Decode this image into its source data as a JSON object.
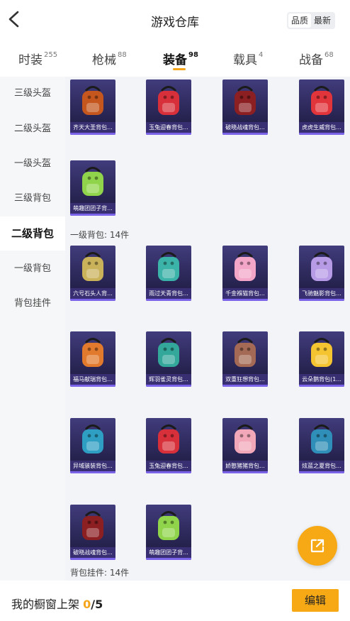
{
  "header": {
    "title": "游戏仓库",
    "sort_options": [
      "品质",
      "最新"
    ],
    "sort_active": "品质"
  },
  "tabs": [
    {
      "label": "时装",
      "count": "255"
    },
    {
      "label": "枪械",
      "count": "88"
    },
    {
      "label": "装备",
      "count": "98"
    },
    {
      "label": "载具",
      "count": "4"
    },
    {
      "label": "战备",
      "count": "68"
    }
  ],
  "active_tab": "装备",
  "sidebar": {
    "items": [
      {
        "label": "三级头盔"
      },
      {
        "label": "二级头盔"
      },
      {
        "label": "一级头盔"
      },
      {
        "label": "三级背包"
      },
      {
        "label": "二级背包"
      },
      {
        "label": "一级背包"
      },
      {
        "label": "背包挂件"
      }
    ],
    "active": "二级背包"
  },
  "sections": [
    {
      "label": "",
      "items": [
        {
          "name": "齐天大圣背包...",
          "icon": "monkey-king-backpack",
          "color": "#c5571e"
        },
        {
          "name": "玉兔迎春背包...",
          "icon": "jade-rabbit-backpack",
          "color": "#d8303a"
        },
        {
          "name": "破晓战魂背包...",
          "icon": "dawn-warrior-backpack",
          "color": "#8b1f22"
        },
        {
          "name": "虎虎生威背包...",
          "icon": "tiger-backpack",
          "color": "#e2343b"
        },
        {
          "name": "萌趣团团子背...",
          "icon": "bunny-dumpling-backpack",
          "color": "#8fd44a"
        }
      ]
    },
    {
      "label": "一级背包: 14件",
      "items": [
        {
          "name": "六号石头人背...",
          "icon": "stone-golem-backpack",
          "color": "#c9b25a"
        },
        {
          "name": "雨过天青背包...",
          "icon": "celadon-backpack",
          "color": "#3cb3a8"
        },
        {
          "name": "千金褓猫背包...",
          "icon": "lucky-cat-backpack",
          "color": "#f3a6c8"
        },
        {
          "name": "飞驰魅影背包...",
          "icon": "phantom-backpack",
          "color": "#b79be6"
        },
        {
          "name": "福马献瑞背包...",
          "icon": "fortune-horse-backpack",
          "color": "#e27a2d"
        },
        {
          "name": "辉羽雀灵背包...",
          "icon": "feather-bird-backpack",
          "color": "#32a79a"
        },
        {
          "name": "双重狂想背包...",
          "icon": "double-fantasy-backpack",
          "color": "#a46a55"
        },
        {
          "name": "云朵鹅背包(1...",
          "icon": "cloud-goose-backpack",
          "color": "#f4c531"
        },
        {
          "name": "异域骇装背包...",
          "icon": "exotic-gear-backpack",
          "color": "#2e9ec2"
        },
        {
          "name": "玉兔迎春背包...",
          "icon": "jade-rabbit-backpack",
          "color": "#d8303a"
        },
        {
          "name": "娇憨猪猪背包...",
          "icon": "piggy-backpack",
          "color": "#f2a8b8"
        },
        {
          "name": "炫蓝之夏背包...",
          "icon": "blue-summer-backpack",
          "color": "#2f8fb8"
        },
        {
          "name": "破晓战魂背包...",
          "icon": "dawn-warrior-backpack",
          "color": "#8b1f22"
        },
        {
          "name": "萌趣团团子背...",
          "icon": "bunny-dumpling-backpack",
          "color": "#8fd44a"
        }
      ]
    },
    {
      "label": "背包挂件: 14件",
      "items": []
    }
  ],
  "fab": {
    "icon": "share-icon"
  },
  "bottom": {
    "label": "我的橱窗上架",
    "current": "0",
    "separator": "/",
    "max": "5",
    "edit_label": "编辑"
  },
  "colors": {
    "accent": "#f6a915",
    "card_top": "#413c7c",
    "card_bottom": "#1d1a3e",
    "card_edge": "#7a63e8"
  }
}
